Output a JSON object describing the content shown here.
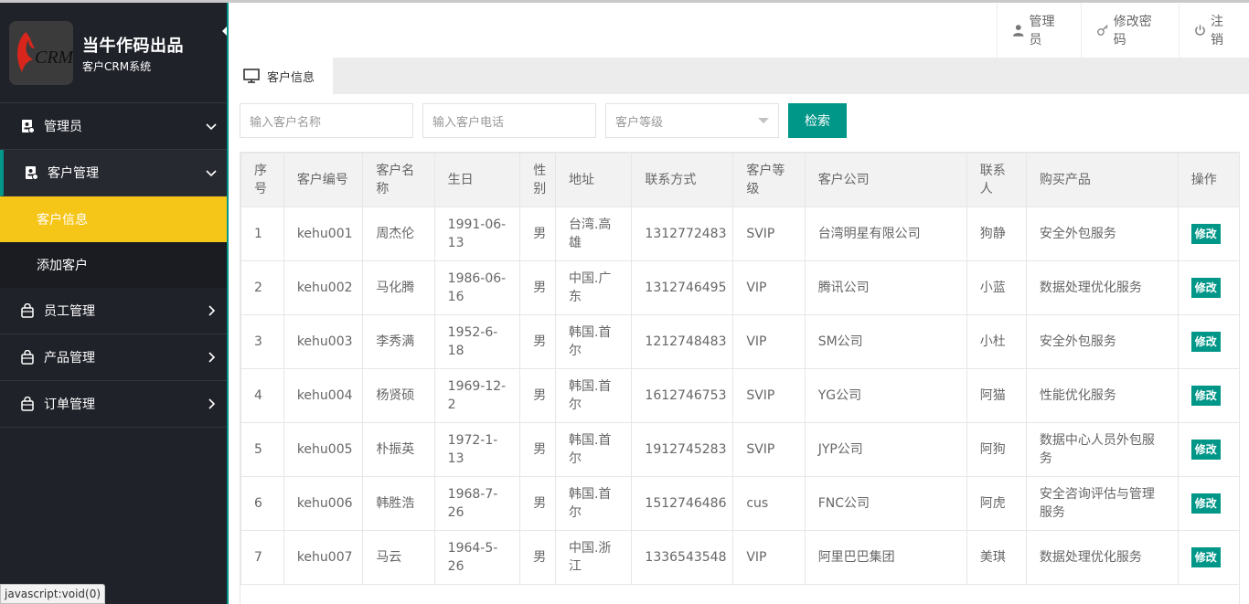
{
  "brand": {
    "title": "当牛作码出品",
    "subtitle": "客户CRM系统",
    "logo_text": "CRM"
  },
  "sidebar": {
    "items": [
      {
        "label": "管理员",
        "icon": "id-card-icon",
        "chevron": "down"
      },
      {
        "label": "客户管理",
        "icon": "id-card-icon",
        "chevron": "down",
        "children": [
          "客户信息",
          "添加客户"
        ],
        "active_child": "客户信息"
      },
      {
        "label": "员工管理",
        "icon": "bag-icon",
        "chevron": "right"
      },
      {
        "label": "产品管理",
        "icon": "bag-icon",
        "chevron": "right"
      },
      {
        "label": "订单管理",
        "icon": "bag-icon",
        "chevron": "right"
      }
    ]
  },
  "header": {
    "links": [
      {
        "label": "管理员",
        "icon": "user-icon"
      },
      {
        "label": "修改密码",
        "icon": "key-icon"
      },
      {
        "label": "注销",
        "icon": "power-icon"
      }
    ]
  },
  "tabs": [
    {
      "label": "客户信息",
      "icon": "monitor-icon",
      "active": true
    }
  ],
  "search": {
    "name_placeholder": "输入客户名称",
    "phone_placeholder": "输入客户电话",
    "level_placeholder": "客户等级",
    "button_label": "检索"
  },
  "table": {
    "columns": [
      "序号",
      "客户编号",
      "客户名称",
      "生日",
      "性别",
      "地址",
      "联系方式",
      "客户等级",
      "客户公司",
      "联系人",
      "购买产品",
      "操作"
    ],
    "edit_label": "修改",
    "rows": [
      [
        "1",
        "kehu001",
        "周杰伦",
        "1991-06-13",
        "男",
        "台湾.高雄",
        "1312772483",
        "SVIP",
        "台湾明星有限公司",
        "狗静",
        "安全外包服务"
      ],
      [
        "2",
        "kehu002",
        "马化腾",
        "1986-06-16",
        "男",
        "中国.广东",
        "1312746495",
        "VIP",
        "腾讯公司",
        "小蓝",
        "数据处理优化服务"
      ],
      [
        "3",
        "kehu003",
        "李秀满",
        "1952-6-18",
        "男",
        "韩国.首尔",
        "1212748483",
        "VIP",
        "SM公司",
        "小杜",
        "安全外包服务"
      ],
      [
        "4",
        "kehu004",
        "杨贤硕",
        "1969-12-2",
        "男",
        "韩国.首尔",
        "1612746753",
        "SVIP",
        "YG公司",
        "阿猫",
        "性能优化服务"
      ],
      [
        "5",
        "kehu005",
        "朴振英",
        "1972-1-13",
        "男",
        "韩国.首尔",
        "1912745283",
        "SVIP",
        "JYP公司",
        "阿狗",
        "数据中心人员外包服务"
      ],
      [
        "6",
        "kehu006",
        "韩胜浩",
        "1968-7-26",
        "男",
        "韩国.首尔",
        "1512746486",
        "cus",
        "FNC公司",
        "阿虎",
        "安全咨询评估与管理服务"
      ],
      [
        "7",
        "kehu007",
        "马云",
        "1964-5-26",
        "男",
        "中国.浙江",
        "1336543548",
        "VIP",
        "阿里巴巴集团",
        "美琪",
        "数据处理优化服务"
      ]
    ]
  },
  "statusbar": {
    "text": "javascript:void(0)"
  },
  "colors": {
    "accent": "#009688",
    "active_menu": "#f5c518",
    "sidebar_bg": "#20222a"
  }
}
